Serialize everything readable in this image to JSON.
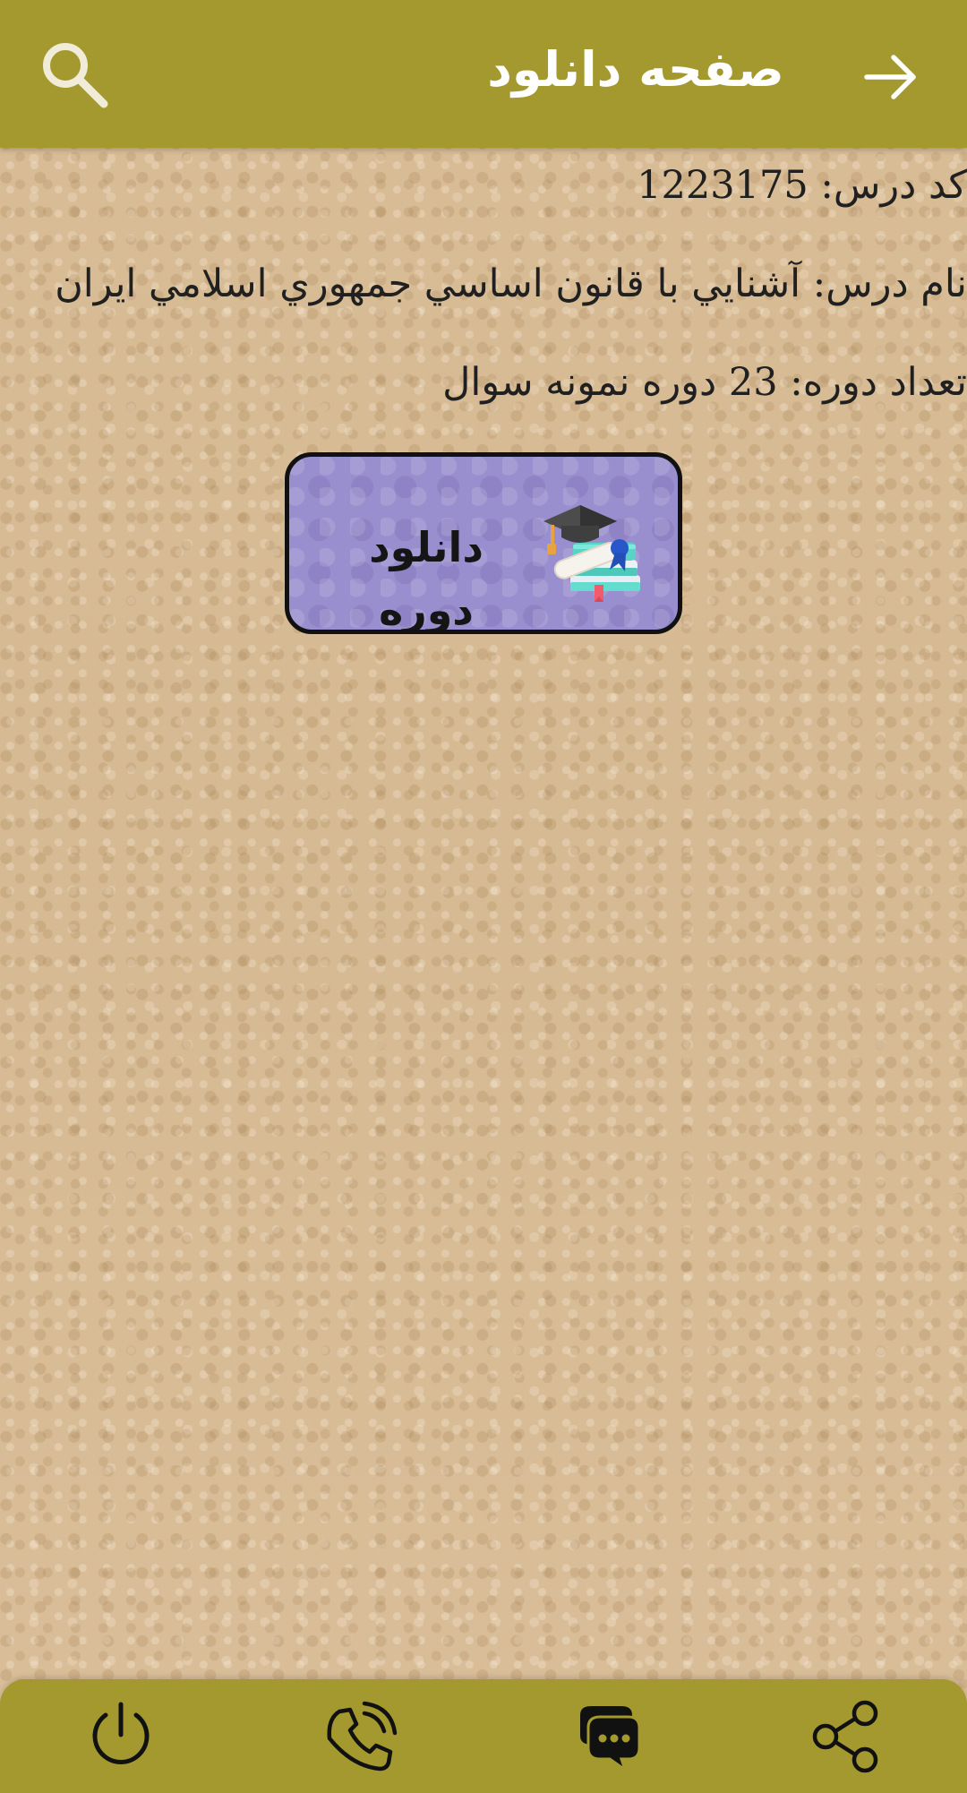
{
  "header": {
    "title": "صفحه دانلود",
    "back_icon": "arrow-right-icon",
    "search_icon": "search-icon",
    "background_color": "#a4992f",
    "text_color": "#ffffff"
  },
  "course": {
    "code_label": "کد درس:",
    "code_value": "1223175",
    "name_label": "نام درس:",
    "name_value": "آشنايي با قانون اساسي جمهوري اسلامي ايران",
    "count_label": "تعداد دوره:",
    "count_value": "23 دوره نمونه سوال",
    "text_color": "#202020"
  },
  "download_card": {
    "label": "دانلود دوره",
    "icon": "graduation-books-icon",
    "background_color": "#9a8fce",
    "border_color": "#111111"
  },
  "bottom_nav": {
    "background_color": "#a4992f",
    "items": [
      {
        "icon": "power-icon"
      },
      {
        "icon": "phone-icon"
      },
      {
        "icon": "chat-icon"
      },
      {
        "icon": "share-icon"
      }
    ]
  },
  "page": {
    "background_color": "#d8bd96"
  }
}
